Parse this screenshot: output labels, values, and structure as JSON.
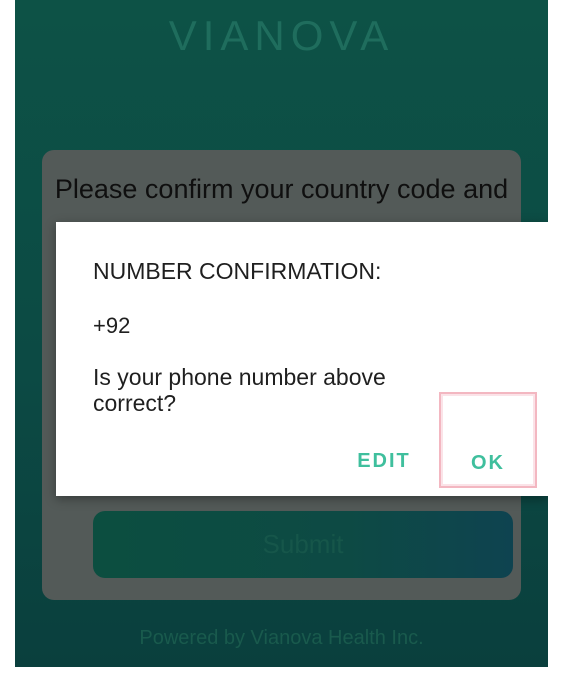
{
  "app": {
    "brand": "VIANOVA",
    "footer": "Powered by Vianova Health Inc."
  },
  "card": {
    "heading": "Please confirm your country code and",
    "submit_label": "Submit"
  },
  "dialog": {
    "title": "NUMBER CONFIRMATION:",
    "number": "+92",
    "question": "Is your phone number above correct?",
    "edit_label": "EDIT",
    "ok_label": "OK"
  },
  "colors": {
    "background": "#0c4a44",
    "accent": "#3fbf9d",
    "highlight": "#f3b7c1"
  }
}
